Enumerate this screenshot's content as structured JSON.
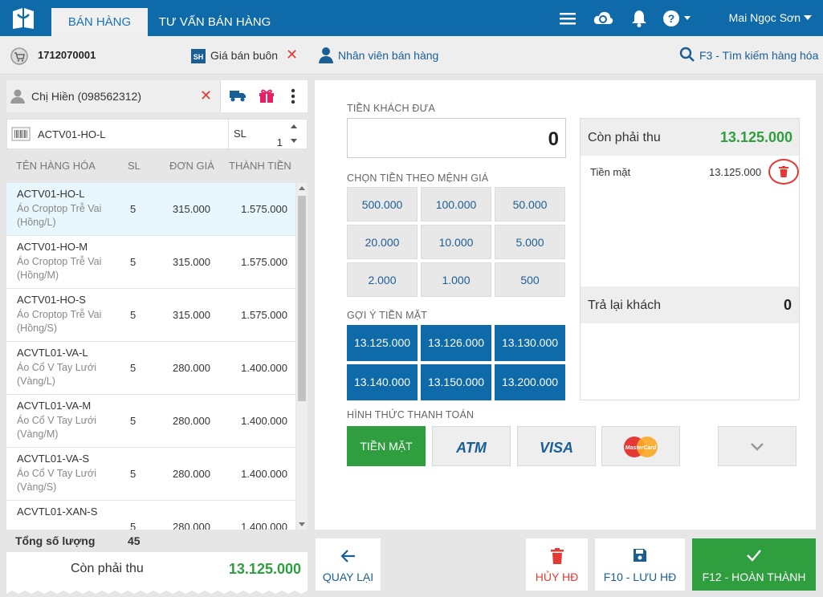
{
  "header": {
    "tabs": [
      "BÁN HÀNG",
      "TƯ VẤN BÁN HÀNG"
    ],
    "user_name": "Mai Ngọc Sơn",
    "icons": [
      "menu-icon",
      "cloud-sync-icon",
      "bell-icon",
      "help-icon"
    ]
  },
  "toolbar": {
    "order_number": "1712070001",
    "price_type": "Giá bán buôn",
    "staff_label": "Nhân viên bán hàng",
    "search_label": "F3 - Tìm kiếm hàng hóa"
  },
  "customer": {
    "name": "Chị Hiền (098562312)"
  },
  "product_input": {
    "code": "ACTV01-HO-L",
    "qty_label": "SL",
    "qty_value": "1"
  },
  "table": {
    "headers": [
      "TÊN HÀNG HÓA",
      "SL",
      "ĐƠN GIÁ",
      "THÀNH TIỀN"
    ],
    "rows": [
      {
        "code": "ACTV01-HO-L",
        "desc": "Áo Croptop Trễ Vai (Hồng/L)",
        "qty": "5",
        "price": "315.000",
        "total": "1.575.000"
      },
      {
        "code": "ACTV01-HO-M",
        "desc": "Áo Croptop Trễ Vai (Hồng/M)",
        "qty": "5",
        "price": "315.000",
        "total": "1.575.000"
      },
      {
        "code": "ACTV01-HO-S",
        "desc": "Áo Croptop Trễ Vai (Hồng/S)",
        "qty": "5",
        "price": "315.000",
        "total": "1.575.000"
      },
      {
        "code": "ACVTL01-VA-L",
        "desc": "Áo Cổ V Tay Lưới (Vàng/L)",
        "qty": "5",
        "price": "280.000",
        "total": "1.400.000"
      },
      {
        "code": "ACVTL01-VA-M",
        "desc": "Áo Cổ V Tay Lưới (Vàng/M)",
        "qty": "5",
        "price": "280.000",
        "total": "1.400.000"
      },
      {
        "code": "ACVTL01-VA-S",
        "desc": "Áo Cổ V Tay Lưới (Vàng/S)",
        "qty": "5",
        "price": "280.000",
        "total": "1.400.000"
      },
      {
        "code": "ACVTL01-XAN-S",
        "desc": "",
        "qty": "5",
        "price": "280.000",
        "total": "1.400.000"
      }
    ],
    "total_qty_label": "Tổng số lượng",
    "total_qty_value": "45"
  },
  "receipt": {
    "label": "Còn phải thu",
    "value": "13.125.000"
  },
  "payment": {
    "cash_given_label": "TIỀN KHÁCH ĐƯA",
    "cash_given_value": "0",
    "denomination_label": "CHỌN TIỀN THEO MỆNH GIÁ",
    "denominations": [
      "500.000",
      "100.000",
      "50.000",
      "20.000",
      "10.000",
      "5.000",
      "2.000",
      "1.000",
      "500"
    ],
    "suggest_label": "GỢI Ý TIỀN MẶT",
    "suggestions": [
      "13.125.000",
      "13.126.000",
      "13.130.000",
      "13.140.000",
      "13.150.000",
      "13.200.000"
    ],
    "method_label": "HÌNH THỨC THANH TOÁN",
    "methods": [
      "TIỀN MẶT",
      "ATM",
      "VISA",
      "MasterCard"
    ],
    "summary": {
      "due_label": "Còn phải thu",
      "due_value": "13.125.000",
      "cash_row_label": "Tiền mặt",
      "cash_row_value": "13.125.000",
      "return_label": "Trả lại khách",
      "return_value": "0"
    }
  },
  "actions": {
    "back": "QUAY LẠI",
    "cancel": "HỦY HĐ",
    "save": "F10 - LƯU HĐ",
    "finish": "F12 - HOÀN THÀNH"
  },
  "colors": {
    "primary": "#0e6aa8",
    "green": "#2f9e3f",
    "red": "#e53935"
  }
}
